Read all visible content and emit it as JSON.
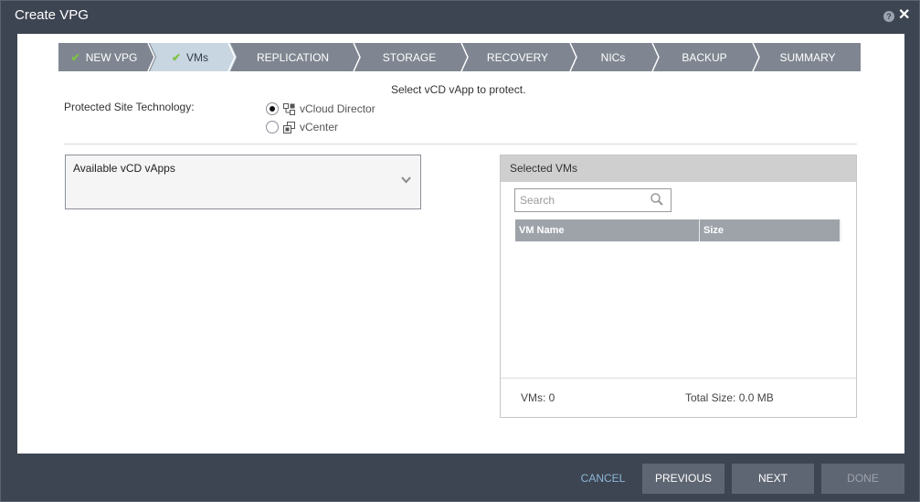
{
  "window": {
    "title": "Create VPG"
  },
  "wizard": {
    "steps": [
      {
        "label": "NEW VPG",
        "completed": true,
        "active": false
      },
      {
        "label": "VMs",
        "completed": true,
        "active": true
      },
      {
        "label": "REPLICATION",
        "completed": false,
        "active": false
      },
      {
        "label": "STORAGE",
        "completed": false,
        "active": false
      },
      {
        "label": "RECOVERY",
        "completed": false,
        "active": false
      },
      {
        "label": "NICs",
        "completed": false,
        "active": false
      },
      {
        "label": "BACKUP",
        "completed": false,
        "active": false
      },
      {
        "label": "SUMMARY",
        "completed": false,
        "active": false
      }
    ]
  },
  "main": {
    "instruction": "Select vCD vApp to protect.",
    "protected_site_label": "Protected Site Technology:",
    "technology_options": [
      {
        "label": "vCloud Director",
        "selected": true,
        "icon": "vcloud-icon"
      },
      {
        "label": "vCenter",
        "selected": false,
        "icon": "vcenter-icon"
      }
    ],
    "available_vapps_label": "Available vCD vApps"
  },
  "selected_vms": {
    "title": "Selected VMs",
    "search_placeholder": "Search",
    "columns": [
      "VM Name",
      "Size"
    ],
    "rows": [],
    "footer_vms": "VMs: 0",
    "footer_total_size": "Total Size: 0.0 MB"
  },
  "buttons": {
    "cancel": "CANCEL",
    "previous": "PREVIOUS",
    "next": "NEXT",
    "done": "DONE"
  },
  "colors": {
    "chrome": "#3e4552",
    "wizard_bar": "#7f8691",
    "active_step": "#c8d6e1",
    "check": "#7ec242",
    "link": "#8bb7d6"
  }
}
